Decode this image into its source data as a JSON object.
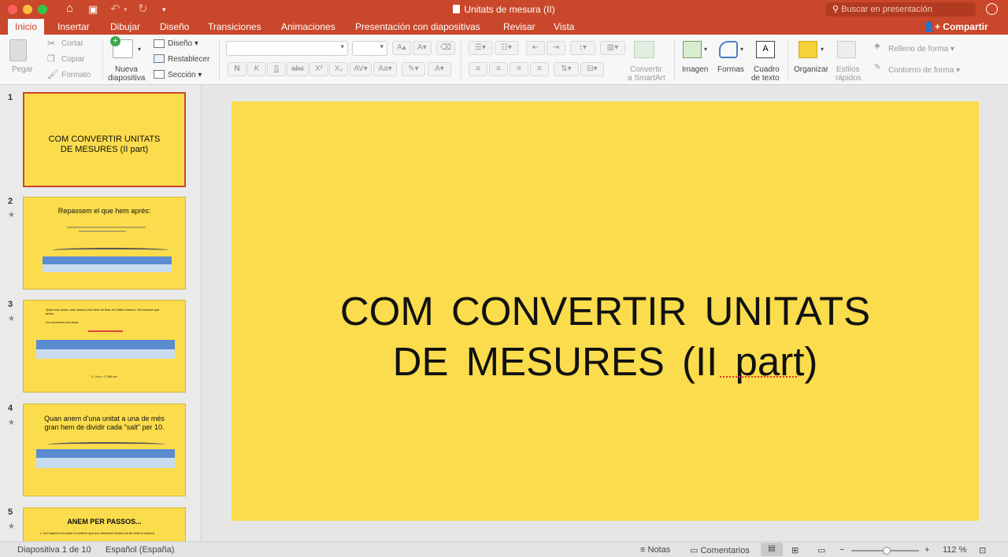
{
  "window": {
    "title": "Unitats de mesura (II)",
    "search_placeholder": "Buscar en presentación"
  },
  "tabs": [
    {
      "label": "Inicio",
      "active": true
    },
    {
      "label": "Insertar"
    },
    {
      "label": "Dibujar"
    },
    {
      "label": "Diseño"
    },
    {
      "label": "Transiciones"
    },
    {
      "label": "Animaciones"
    },
    {
      "label": "Presentación con diapositivas"
    },
    {
      "label": "Revisar"
    },
    {
      "label": "Vista"
    }
  ],
  "share_label": "Compartir",
  "ribbon": {
    "clipboard": {
      "paste": "Pegar",
      "cut": "Cortar",
      "copy": "Copiar",
      "format": "Formato"
    },
    "slides": {
      "new_slide_1": "Nueva",
      "new_slide_2": "diapositiva",
      "layout": "Diseño",
      "reset": "Restablecer",
      "section": "Sección"
    },
    "format_buttons": [
      "N",
      "K",
      "S",
      "abc",
      "X²",
      "X₂"
    ],
    "smartart_1": "Convertir",
    "smartart_2": "a SmartArt",
    "image": "Imagen",
    "shapes": "Formas",
    "textbox_1": "Cuadro",
    "textbox_2": "de texto",
    "arrange": "Organizar",
    "styles_1": "Estilos",
    "styles_2": "rápidos",
    "shape_fill": "Relleno de forma",
    "shape_outline": "Contorno de forma"
  },
  "thumbnails": [
    {
      "num": "1",
      "title": "COM  CONVERTIR  UNITATS\nDE  MESURES (II part)"
    },
    {
      "num": "2",
      "title": "Repassem el que hem après:",
      "starred": true
    },
    {
      "num": "3",
      "title": "Quan ens donen una mesura ens hem de fixar en l'últim número: l'és mesura que tenim.",
      "subtitle": "Ho escriurem a la taula:",
      "footer": "1 -3 m = 1 300 cm",
      "starred": true
    },
    {
      "num": "4",
      "title": "Quan anem d'una unitat a una de més\ngran hem de dividir cada \"salt\" per 10.",
      "starred": true
    },
    {
      "num": "5",
      "title": "ANEM  PER  PASSOS...",
      "subtitle": "1.  Col·loquem a la taula el nombre que ens demanen fixant-nos bé amb la mesura",
      "starred": true
    }
  ],
  "slide": {
    "title": "COM  CONVERTIR  UNITATS\nDE  MESURES (II part)"
  },
  "status": {
    "slide_count": "Diapositiva 1 de 10",
    "language": "Español (España)",
    "notes": "Notas",
    "comments": "Comentarios",
    "zoom": "112 %"
  },
  "colors": {
    "accent": "#c9472a",
    "slide_bg": "#fbdc4c"
  }
}
